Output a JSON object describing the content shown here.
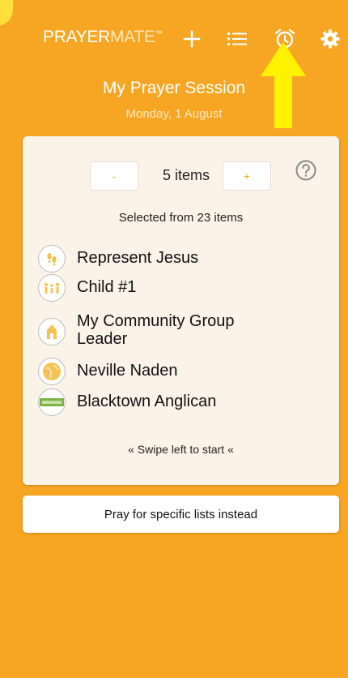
{
  "app": {
    "logo_prayer": "PRAYER",
    "logo_mate": "MATE",
    "logo_tm": "™"
  },
  "toolbar": {
    "icons": [
      "plus-icon",
      "list-icon",
      "alarm-clock-icon",
      "gear-icon"
    ]
  },
  "annotation": {
    "color": "#fff200"
  },
  "session": {
    "title": "My Prayer Session",
    "date": "Monday, 1 August"
  },
  "stepper": {
    "minus_label": "-",
    "count": "5 items",
    "plus_label": "+"
  },
  "selected_from": "Selected from 23 items",
  "items": [
    {
      "label": "Represent Jesus",
      "icon": "footprints-icon"
    },
    {
      "label": "Child #1",
      "icon": "family-icon"
    },
    {
      "label": "My Community Group Leader",
      "icon": "church-icon"
    },
    {
      "label": "Neville Naden",
      "icon": "globe-icon"
    },
    {
      "label": "Blacktown Anglican",
      "icon": "church-logo-icon"
    }
  ],
  "swipe_hint": "« Swipe left to start «",
  "specific_lists_button": "Pray for specific lists instead",
  "colors": {
    "background": "#f6a623",
    "card": "#fcf3e8",
    "accent": "#f6a623"
  }
}
